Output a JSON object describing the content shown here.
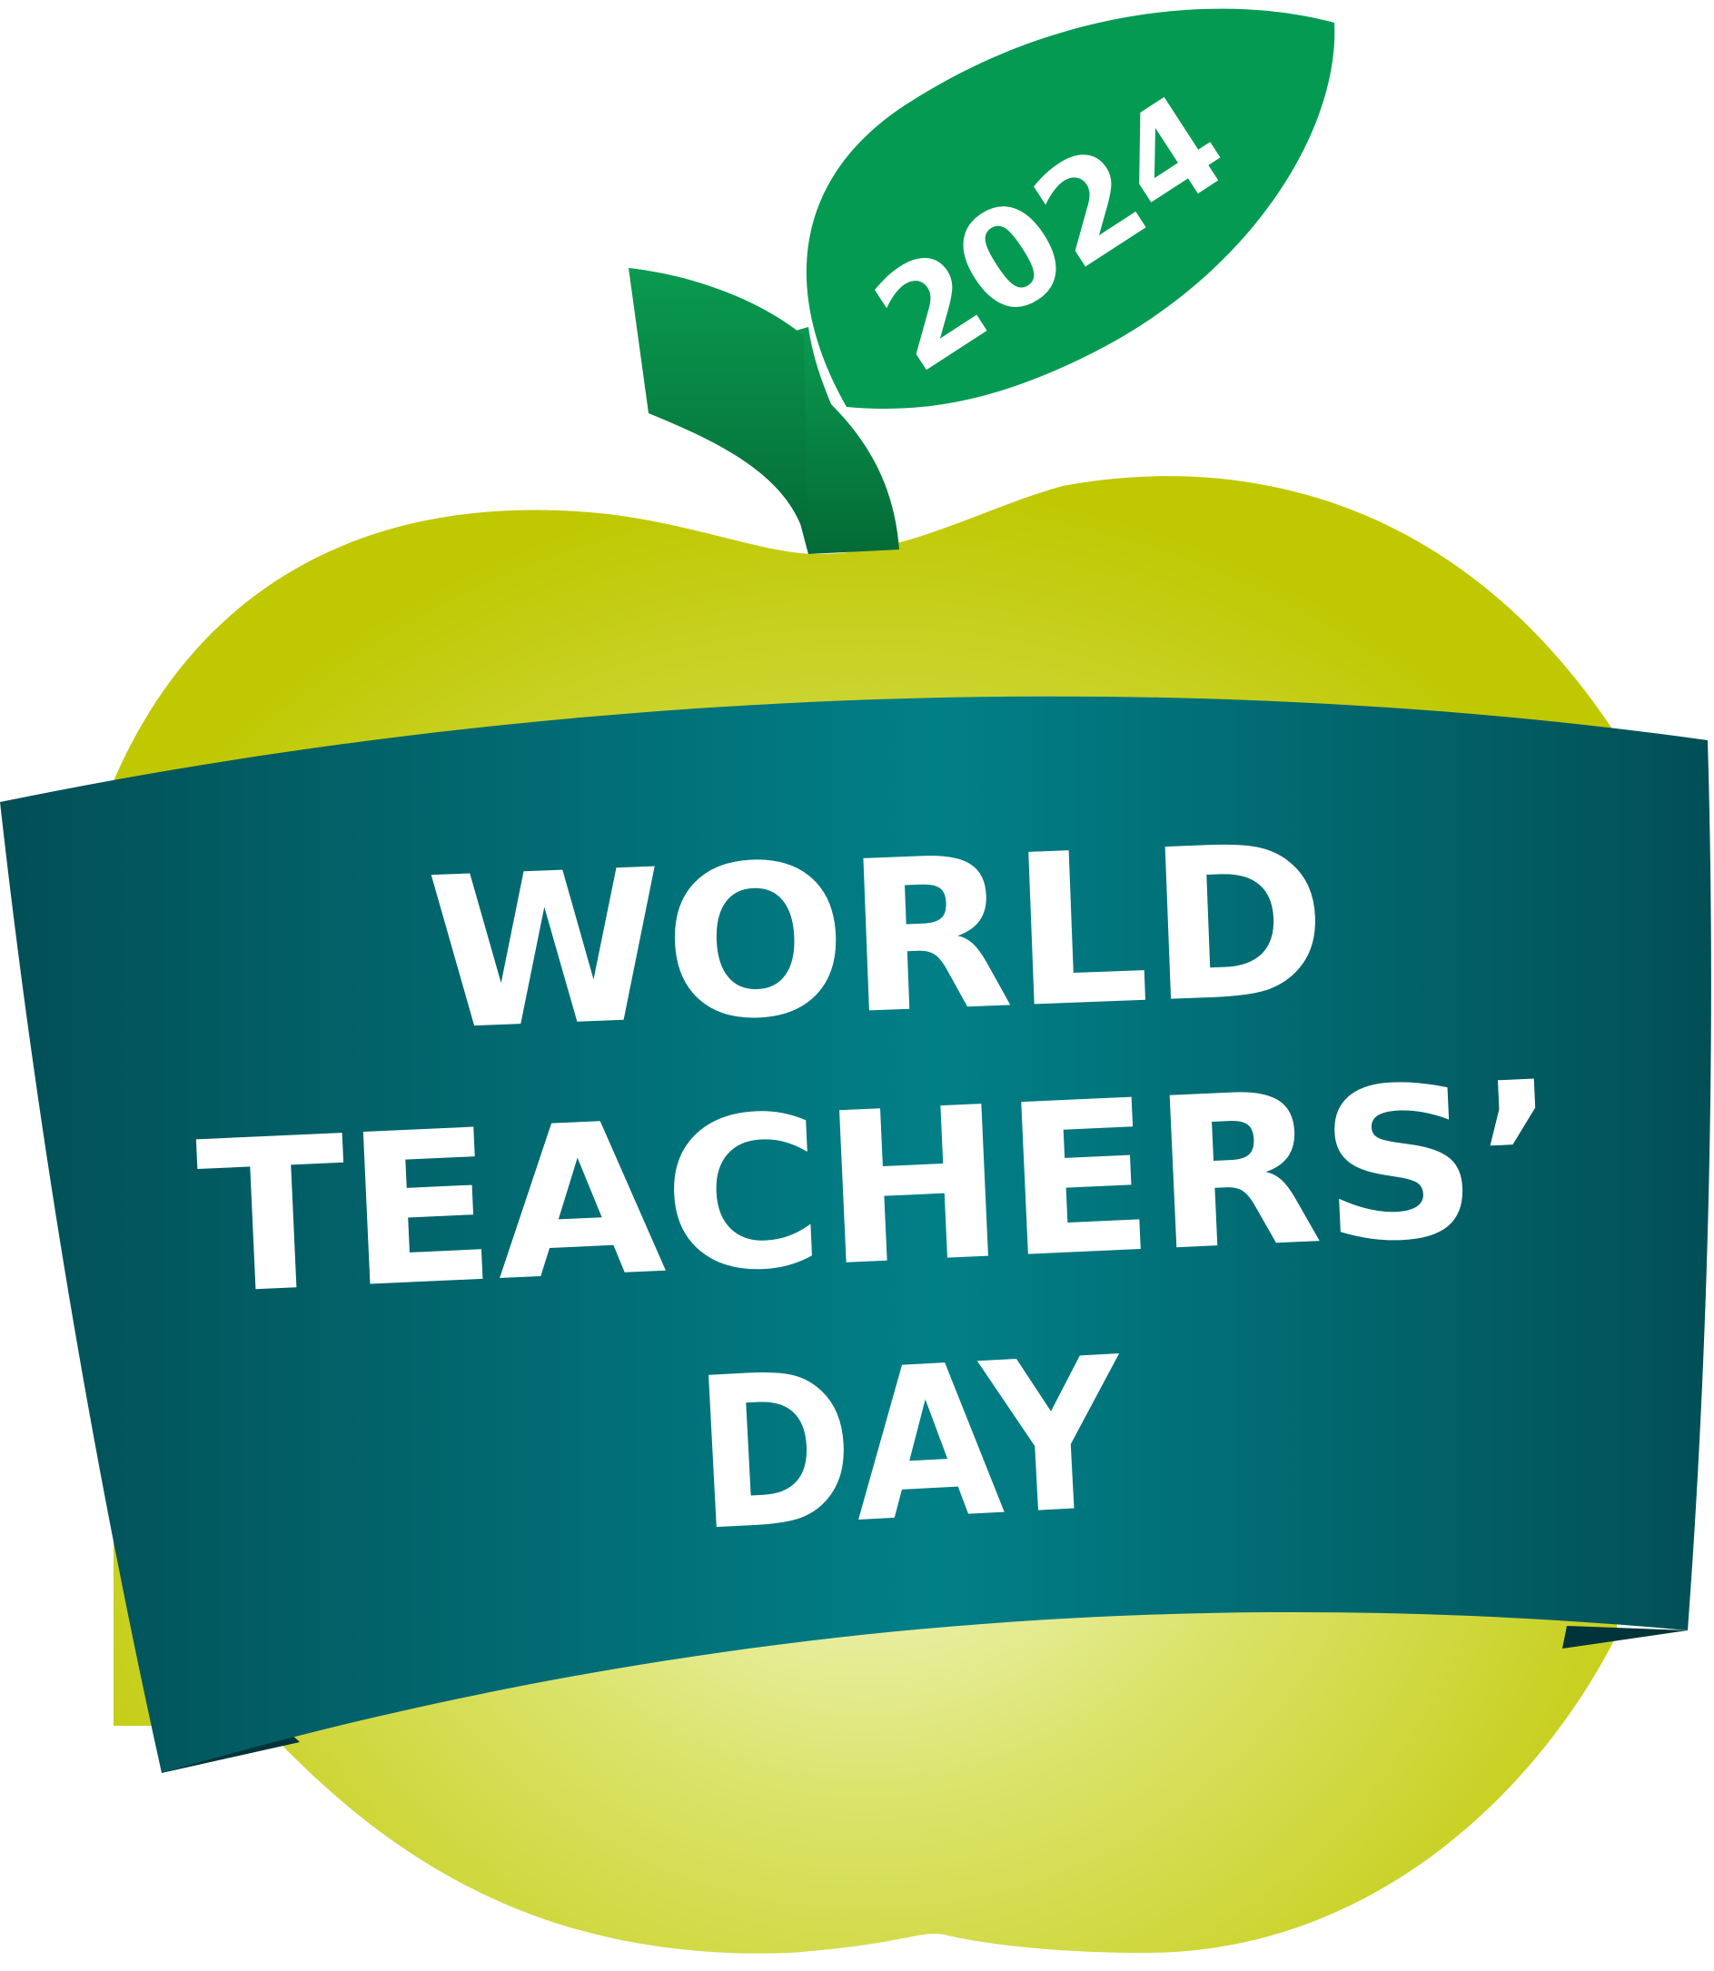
{
  "logo": {
    "year": "2024",
    "line1": "WORLD",
    "line2": "TEACHERS’",
    "line3": "DAY"
  },
  "colors": {
    "apple_edge": "#bfc800",
    "apple_highlight": "#f6fbe0",
    "leaf": "#049a52",
    "stem_top": "#0a9a4f",
    "stem_bottom": "#056b38",
    "ribbon_center": "#017f87",
    "ribbon_edge": "#024f56",
    "ribbon_fold": "#01343a",
    "text": "#ffffff"
  }
}
